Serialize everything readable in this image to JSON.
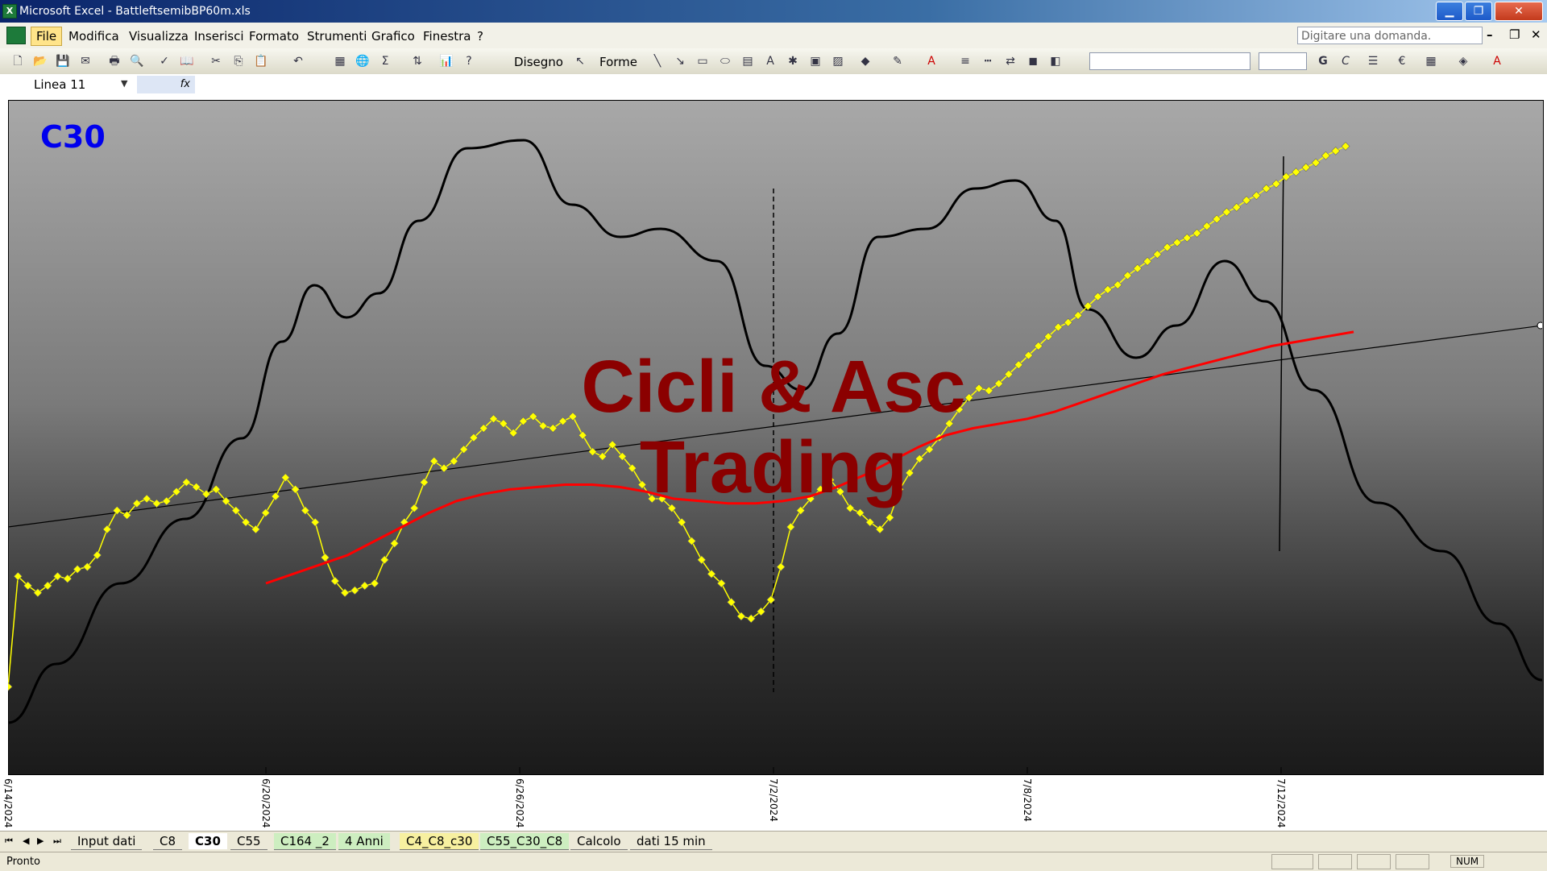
{
  "window": {
    "title": "Microsoft Excel - BattleftsemibBP60m.xls",
    "controls": [
      "▁",
      "❐",
      "✕"
    ]
  },
  "menu": {
    "items": [
      "File",
      "Modifica",
      "Visualizza",
      "Inserisci",
      "Formato",
      "Strumenti",
      "Grafico",
      "Finestra",
      "?"
    ],
    "ask_placeholder": "Digitare una domanda."
  },
  "toolbar": {
    "draw_label": "Disegno",
    "shapes_label": "Forme",
    "bold": "G",
    "italic": "C",
    "euro": "€"
  },
  "namebox": {
    "value": "Linea 11"
  },
  "chart": {
    "series_label": "C30",
    "watermark_line1": "Cicli & Asc",
    "watermark_line2": "Trading"
  },
  "chart_data": {
    "type": "line",
    "x_tick_labels": [
      "6/14/2024",
      "6/20/2024",
      "6/26/2024",
      "7/2/2024",
      "7/8/2024",
      "7/12/2024"
    ],
    "colors": {
      "price": "#ffff00",
      "average": "#ff0000",
      "cycle": "#000000",
      "trendline": "#000000"
    },
    "series": [
      {
        "name": "price",
        "values": [
          0.04,
          0.51,
          0.47,
          0.44,
          0.47,
          0.51,
          0.5,
          0.54,
          0.55,
          0.6,
          0.71,
          0.79,
          0.77,
          0.82,
          0.84,
          0.82,
          0.83,
          0.87,
          0.91,
          0.89,
          0.86,
          0.88,
          0.83,
          0.79,
          0.74,
          0.71,
          0.78,
          0.85,
          0.93,
          0.88,
          0.79,
          0.74,
          0.59,
          0.49,
          0.44,
          0.45,
          0.47,
          0.48,
          0.58,
          0.65,
          0.74,
          0.8,
          0.91,
          1.0,
          0.97,
          1.0,
          1.05,
          1.1,
          1.14,
          1.18,
          1.16,
          1.12,
          1.17,
          1.19,
          1.15,
          1.14,
          1.17,
          1.19,
          1.11,
          1.04,
          1.02,
          1.07,
          1.02,
          0.97,
          0.9,
          0.84,
          0.84,
          0.8,
          0.74,
          0.66,
          0.58,
          0.52,
          0.48,
          0.4,
          0.34,
          0.33,
          0.36,
          0.41,
          0.55,
          0.72,
          0.79,
          0.84,
          0.88,
          0.92,
          0.87,
          0.8,
          0.78,
          0.74,
          0.71,
          0.76,
          0.88,
          0.95,
          1.01,
          1.05,
          1.1,
          1.16,
          1.22,
          1.27,
          1.31,
          1.3,
          1.33,
          1.37,
          1.41,
          1.45,
          1.49,
          1.53,
          1.57,
          1.59,
          1.62,
          1.66,
          1.7,
          1.73,
          1.75,
          1.79,
          1.82,
          1.85,
          1.88,
          1.91,
          1.93,
          1.95,
          1.97,
          2.0,
          2.03,
          2.06,
          2.08,
          2.11,
          2.13,
          2.16,
          2.18,
          2.21,
          2.23,
          2.25,
          2.27,
          2.3,
          2.32,
          2.34
        ]
      },
      {
        "name": "average",
        "values": [
          0.48,
          0.52,
          0.56,
          0.6,
          0.66,
          0.72,
          0.78,
          0.83,
          0.86,
          0.88,
          0.89,
          0.9,
          0.9,
          0.89,
          0.87,
          0.84,
          0.83,
          0.82,
          0.82,
          0.83,
          0.85,
          0.89,
          0.94,
          1.0,
          1.06,
          1.11,
          1.14,
          1.16,
          1.18,
          1.21,
          1.25,
          1.29,
          1.33,
          1.37,
          1.4,
          1.43,
          1.46,
          1.49,
          1.51,
          1.53,
          1.55
        ]
      }
    ],
    "ylim": [
      0,
      2.4
    ]
  },
  "sheet_tabs": [
    "Input dati",
    "C8",
    "C30",
    "C55",
    "C164 _2",
    "4 Anni",
    "C4_C8_c30",
    "C55_C30_C8",
    "Calcolo",
    "dati 15 min"
  ],
  "active_sheet": "C30",
  "status": {
    "left": "Pronto",
    "num": "NUM"
  }
}
